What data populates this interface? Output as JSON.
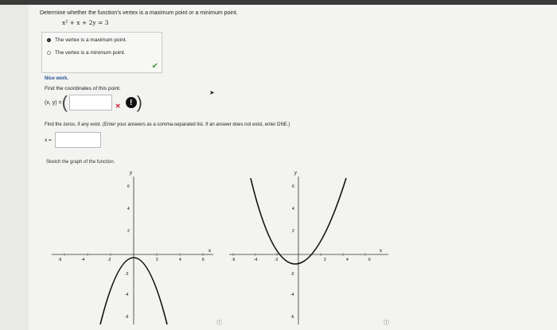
{
  "question": "Determine whether the function's vertex is a maximum point or a minimum point.",
  "equation": "x² + x + 2y = 3",
  "choices": [
    {
      "label": "The vertex is a maximum point.",
      "selected": true
    },
    {
      "label": "The vertex is a minimum point.",
      "selected": false
    }
  ],
  "feedback": "Nice work.",
  "coords_prompt": "Find the coordinates of this point.",
  "coords_label": "(x, y) =",
  "zeros_prompt": "Find the zeros, if any exist. (Enter your answers as a comma-separated list. If an answer does not exist, enter DNE.)",
  "zeros_label": "x =",
  "sketch_prompt": "Sketch the graph of the function.",
  "graph1": {
    "x_ticks": [
      "-6",
      "-4",
      "-2",
      "2",
      "4",
      "6"
    ],
    "y_ticks": [
      "6",
      "4",
      "2",
      "-2",
      "-4",
      "-6"
    ],
    "x_label": "x",
    "y_label": "y"
  },
  "graph2": {
    "x_ticks": [
      "-6",
      "-4",
      "-2",
      "2",
      "4",
      "6"
    ],
    "y_ticks": [
      "6",
      "4",
      "2",
      "-2",
      "-4",
      "-6"
    ],
    "x_label": "x",
    "y_label": "y"
  },
  "colors": {
    "correct": "#3a9a3a",
    "wrong": "#cc1122",
    "feedback": "#1d4f8f"
  }
}
